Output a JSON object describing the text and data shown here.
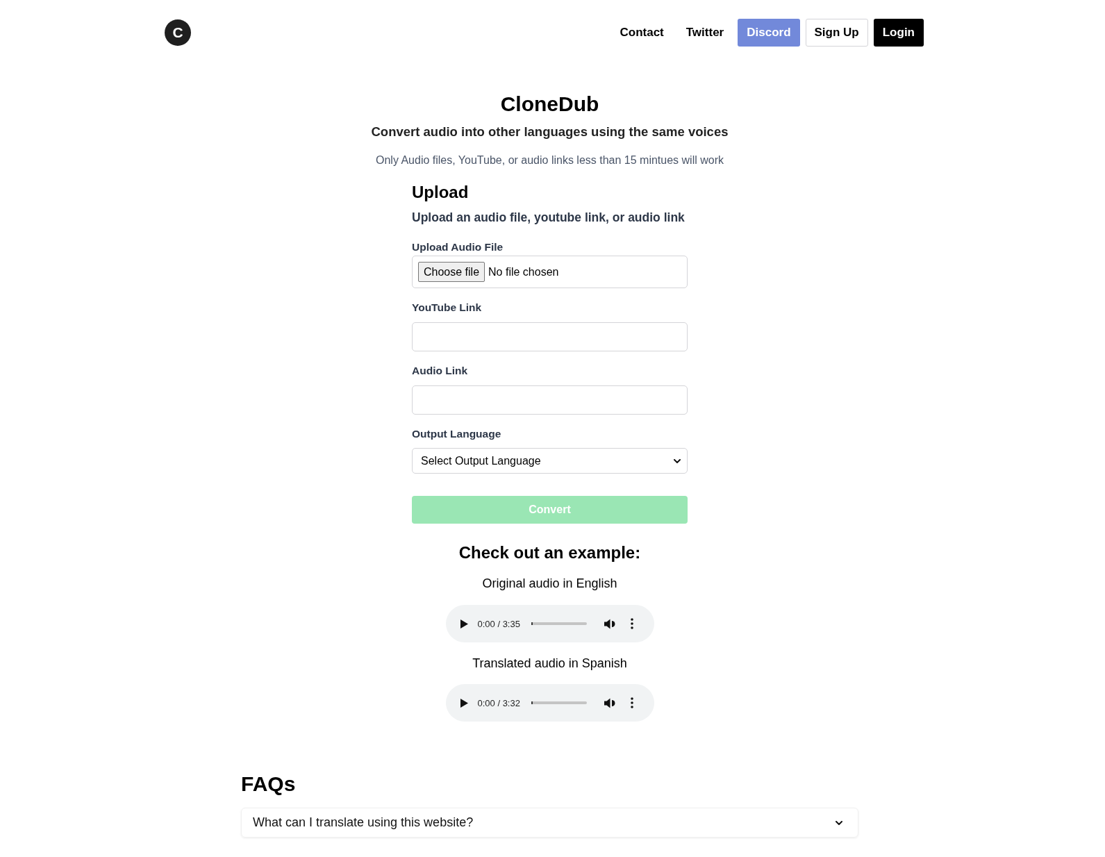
{
  "header": {
    "logo": "C",
    "nav": [
      {
        "label": "Contact",
        "kind": "link"
      },
      {
        "label": "Twitter",
        "kind": "link"
      },
      {
        "label": "Discord",
        "kind": "discord"
      },
      {
        "label": "Sign Up",
        "kind": "outline"
      },
      {
        "label": "Login",
        "kind": "dark"
      }
    ]
  },
  "hero": {
    "title": "CloneDub",
    "subtitle": "Convert audio into other languages using the same voices",
    "note": "Only Audio files, YouTube, or audio links less than 15 mintues will work"
  },
  "upload": {
    "title": "Upload",
    "subtitle": "Upload an audio file, youtube link, or audio link",
    "fields": [
      {
        "kind": "file",
        "label": "Upload Audio File",
        "button": "Choose file",
        "value": "No file chosen"
      },
      {
        "kind": "text",
        "label": "YouTube Link"
      },
      {
        "kind": "text",
        "label": "Audio Link"
      },
      {
        "kind": "select",
        "label": "Output Language",
        "value": "Select Output Language"
      }
    ],
    "submit": {
      "label": "Convert",
      "disabled": true
    }
  },
  "examples": {
    "title": "Check out an example:",
    "players": [
      {
        "caption": "Original audio in English",
        "time": "0:00 / 3:35",
        "level": 0
      },
      {
        "caption": "Translated audio in Spanish",
        "time": "0:00 / 3:32",
        "level": 0
      }
    ]
  },
  "faq": {
    "title": "FAQs",
    "items": [
      {
        "question": "What can I translate using this website?",
        "expanded": false
      }
    ]
  }
}
